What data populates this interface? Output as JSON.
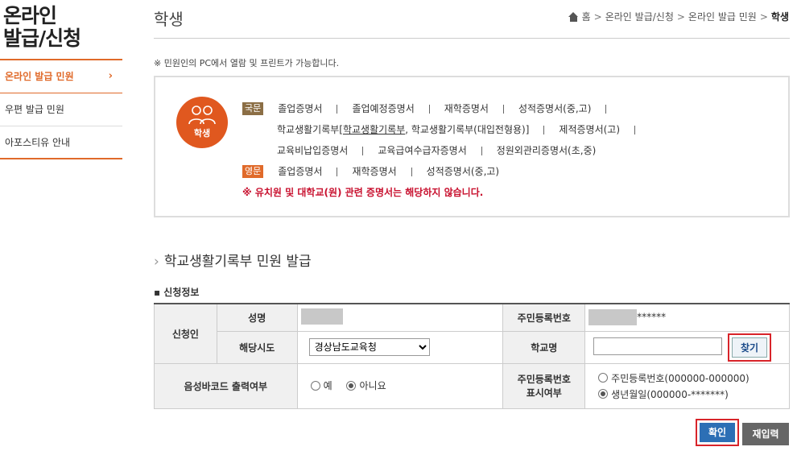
{
  "sidebar": {
    "title_line1": "온라인",
    "title_line2": "발급/신청",
    "items": [
      {
        "label": "온라인 발급 민원",
        "chevron": "›"
      },
      {
        "label": "우편 발급 민원"
      },
      {
        "label": "아포스티유 안내"
      }
    ]
  },
  "header": {
    "title": "학생",
    "breadcrumb": [
      "홈",
      "온라인 발급/신청",
      "온라인 발급 민원",
      "학생"
    ],
    "separator": ">"
  },
  "notice": "※ 민원인의 PC에서 열람 및 프린트가 가능합니다.",
  "info": {
    "icon_label": "학생",
    "korean_tag": "국문",
    "english_tag": "영문",
    "korean_row1": [
      "졸업증명서",
      "졸업예정증명서",
      "재학증명서",
      "성적증명서(중,고)"
    ],
    "korean_row2_prefix": "학교생활기록부[",
    "korean_row2_link": "학교생활기록부",
    "korean_row2_suffix": ", 학교생활기록부(대입전형용)]",
    "korean_row2_last": "제적증명서(고)",
    "korean_row3": [
      "교육비납입증명서",
      "교육급여수급자증명서",
      "정원외관리증명서(초,중)"
    ],
    "english_row": [
      "졸업증명서",
      "재학증명서",
      "성적증명서(중,고)"
    ],
    "warning": "※ 유치원 및 대학교(원) 관련 증명서는 해당하지 않습니다."
  },
  "section": {
    "arrow": "›",
    "title": "학교생활기록부 민원 발급",
    "subtitle": "▪ 신청정보"
  },
  "form": {
    "applicant_label": "신청인",
    "name_label": "성명",
    "rrn_label": "주민등록번호",
    "rrn_masked": "******",
    "region_label": "해당시도",
    "region_value": "경상남도교육청",
    "school_label": "학교명",
    "school_value": "",
    "find_label": "찾기",
    "voice_label": "음성바코드 출력여부",
    "voice_yes": "예",
    "voice_no": "아니요",
    "rrn_display_label_1": "주민등록번호",
    "rrn_display_label_2": "표시여부",
    "rrn_option_full": "주민등록번호(000000-000000)",
    "rrn_option_birth": "생년월일(000000-*******)"
  },
  "buttons": {
    "confirm": "확인",
    "reset": "재입력"
  },
  "colors": {
    "accent": "#e06a2a",
    "highlight": "#d8242a",
    "primary": "#2c6fb5"
  }
}
